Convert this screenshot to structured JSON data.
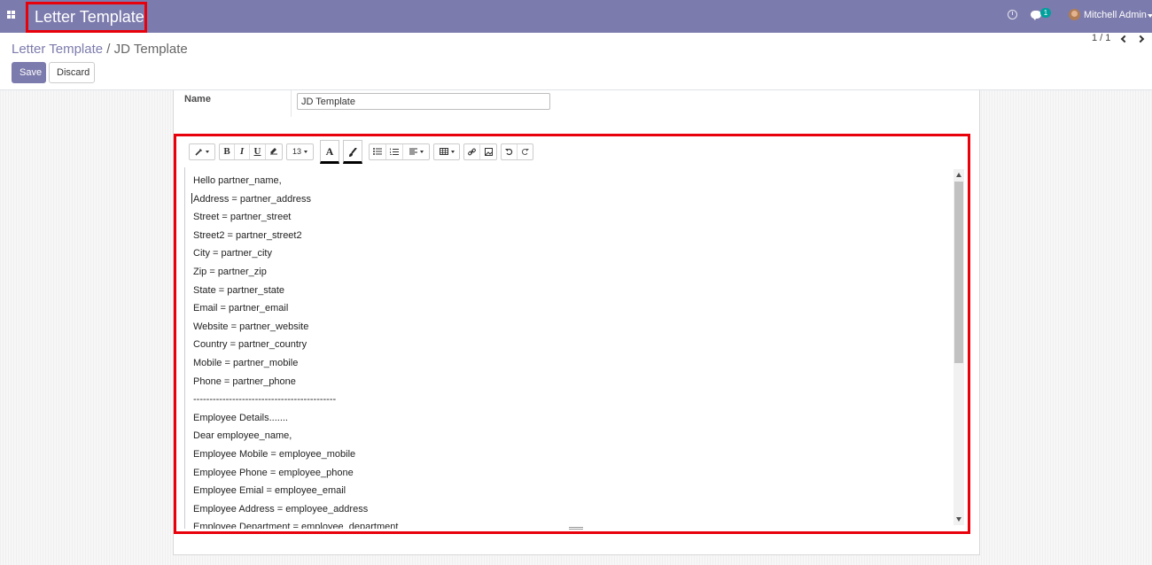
{
  "navbar": {
    "app_title": "Letter Template",
    "chat_count": "1",
    "user_name": "Mitchell Admin",
    "color": "#7c7bad"
  },
  "breadcrumb": {
    "parent": "Letter Template",
    "separator": "/",
    "current": "JD Template"
  },
  "buttons": {
    "save": "Save",
    "discard": "Discard"
  },
  "pager": {
    "value": "1 / 1"
  },
  "form": {
    "name_label": "Name",
    "name_value": "JD Template"
  },
  "toolbar": {
    "font_size": "13",
    "bold": "B",
    "italic": "I",
    "underline": "U",
    "font_color": "A",
    "icons": [
      "magic-wand-icon",
      "bold-icon",
      "italic-icon",
      "underline-icon",
      "eraser-icon",
      "font-size-dropdown",
      "text-color-icon",
      "highlight-brush-icon",
      "bullet-list-icon",
      "numbered-list-icon",
      "align-icon",
      "table-icon",
      "link-icon",
      "image-icon",
      "undo-icon",
      "redo-icon"
    ]
  },
  "editor": {
    "lines": [
      "Hello partner_name,",
      "Address = partner_address",
      "Street = partner_street",
      "Street2 = partner_street2",
      "City = partner_city",
      "Zip = partner_zip",
      "State = partner_state",
      "Email = partner_email",
      "Website = partner_website",
      "Country = partner_country",
      "Mobile = partner_mobile",
      "Phone = partner_phone",
      "--------------------------------------------",
      "Employee Details.......",
      "Dear employee_name,",
      "Employee Mobile = employee_mobile",
      "Employee Phone = employee_phone",
      "Employee Emial = employee_email",
      "Employee Address = employee_address",
      "Employee Department = employee_department"
    ]
  },
  "highlight_color": "#e8000b"
}
